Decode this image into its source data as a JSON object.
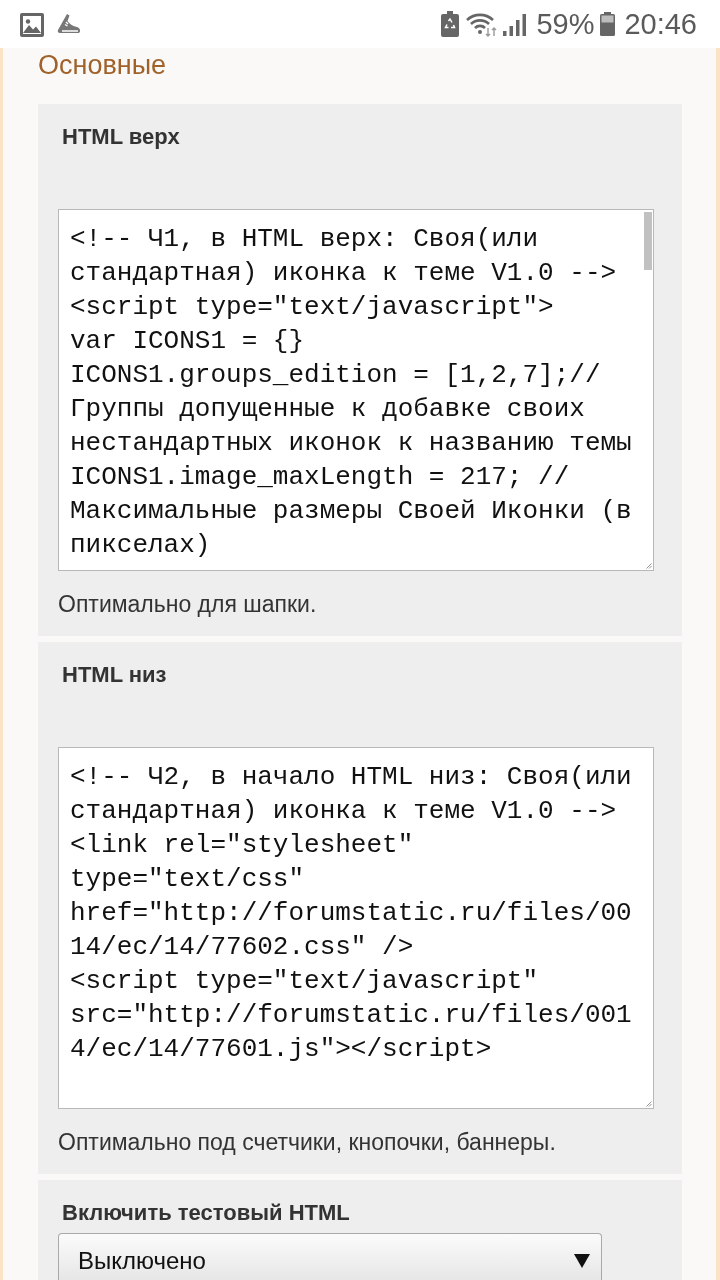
{
  "status_bar": {
    "battery_percent": "59%",
    "time": "20:46"
  },
  "section": {
    "title": "Основные"
  },
  "panels": [
    {
      "kind": "textarea",
      "label": "HTML верх",
      "value": "<!-- Ч1, в HTML верх: Своя(или\nстандартная) иконка к теме V1.0 -->\n<script type=\"text/javascript\">\nvar ICONS1 = {}\nICONS1.groups_edition = [1,2,7];//\nГруппы допущенные к добавке cвоих\nнестандартных иконок к названию темы\nICONS1.image_maxLength = 217; //\nМаксимальные размеры Своей Иконки (в\nпикселах)",
      "scrollable": true,
      "hint": "Оптимально для шапки."
    },
    {
      "kind": "textarea",
      "label": "HTML низ",
      "value": "<!-- Ч2, в начало HTML низ: Своя(или\nстандартная) иконка к теме V1.0 -->\n<link rel=\"stylesheet\"\ntype=\"text/css\"\nhref=\"http://forumstatic.ru/files/00\n14/ec/14/77602.css\" />\n<script type=\"text/javascript\"\nsrc=\"http://forumstatic.ru/files/001\n4/ec/14/77601.js\"></script>",
      "scrollable": false,
      "hint": "Оптимально под счетчики, кнопочки, баннеры."
    },
    {
      "kind": "select",
      "label": "Включить тестовый HTML",
      "value": "Выключено"
    }
  ]
}
